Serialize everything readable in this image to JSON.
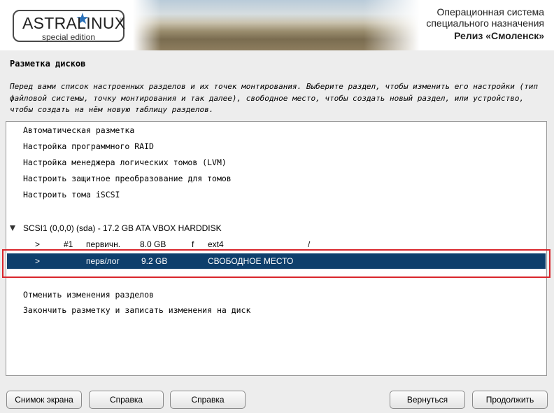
{
  "header": {
    "logo_text": "ASTRALINUX",
    "logo_reg": "®",
    "logo_sub": "special edition",
    "os_line1": "Операционная система",
    "os_line2": "специального назначения",
    "release": "Релиз «Смоленск»"
  },
  "page": {
    "title": "Разметка дисков",
    "description": "Перед вами список настроенных разделов и их точек монтирования. Выберите раздел, чтобы изменить его настройки (тип файловой системы, точку монтирования и так далее), свободное место, чтобы создать новый раздел, или устройство, чтобы создать на нём новую таблицу разделов."
  },
  "list": {
    "items": [
      "Автоматическая разметка",
      "Настройка программного RAID",
      "Настройка менеджера логических томов (LVM)",
      "Настроить защитное преобразование для томов",
      "Настроить тома iSCSI"
    ],
    "disk": "SCSI1 (0,0,0) (sda) - 17.2 GB ATA VBOX HARDDISK",
    "partition1": {
      "arrow": ">",
      "num": "#1",
      "type": "первичн.",
      "size": "8.0 GB",
      "flag": "f",
      "fs": "ext4",
      "mount": "/"
    },
    "free": {
      "arrow": ">",
      "type": "перв/лог",
      "size": "9.2 GB",
      "label": "СВОБОДНОЕ МЕСТО"
    },
    "actions": [
      "Отменить изменения разделов",
      "Закончить разметку и записать изменения на диск"
    ]
  },
  "buttons": {
    "screenshot": "Снимок экрана",
    "help1": "Справка",
    "help2": "Справка",
    "back": "Вернуться",
    "continue": "Продолжить"
  },
  "colors": {
    "selection": "#0e3f6c",
    "highlight_box": "#d9262c",
    "logo_star": "#2a70b8"
  }
}
